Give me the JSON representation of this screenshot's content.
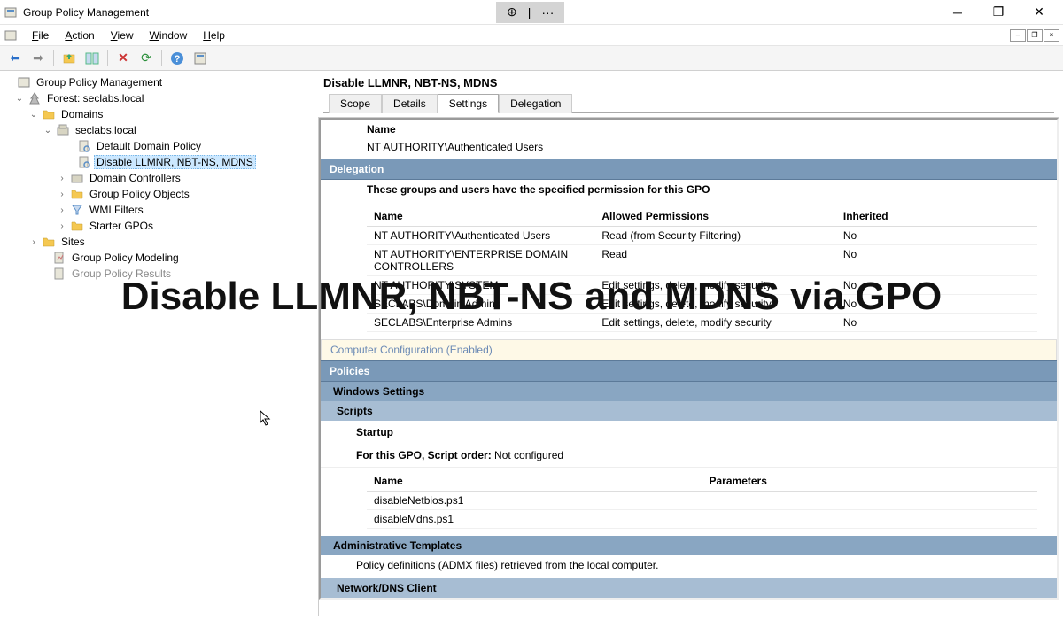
{
  "window": {
    "title": "Group Policy Management"
  },
  "menus": {
    "file": "File",
    "action": "Action",
    "view": "View",
    "window": "Window",
    "help": "Help"
  },
  "toolbar_tools": {
    "zoom": "⊕",
    "sep": "|",
    "more": "···"
  },
  "tree": {
    "root": "Group Policy Management",
    "forest": "Forest: seclabs.local",
    "domains": "Domains",
    "domain": "seclabs.local",
    "items": {
      "default_policy": "Default Domain Policy",
      "disable": "Disable LLMNR, NBT-NS, MDNS",
      "dc": "Domain Controllers",
      "gpo": "Group Policy Objects",
      "wmi": "WMI Filters",
      "starter": "Starter GPOs"
    },
    "sites": "Sites",
    "modeling": "Group Policy Modeling",
    "results": "Group Policy Results"
  },
  "detail": {
    "title": "Disable LLMNR, NBT-NS, MDNS",
    "tabs": {
      "scope": "Scope",
      "details": "Details",
      "settings": "Settings",
      "delegation": "Delegation"
    },
    "name_label": "Name",
    "auth_users": "NT AUTHORITY\\Authenticated Users",
    "delegation": {
      "header": "Delegation",
      "desc": "These groups and users have the specified permission for this GPO",
      "cols": {
        "name": "Name",
        "perms": "Allowed Permissions",
        "inherited": "Inherited"
      },
      "rows": [
        {
          "name": "NT AUTHORITY\\Authenticated Users",
          "perms": "Read (from Security Filtering)",
          "inh": "No"
        },
        {
          "name": "NT AUTHORITY\\ENTERPRISE DOMAIN CONTROLLERS",
          "perms": "Read",
          "inh": "No"
        },
        {
          "name": "NT AUTHORITY\\SYSTEM",
          "perms": "Edit settings, delete, modify security",
          "inh": "No"
        },
        {
          "name": "SECLABS\\Domain Admins",
          "perms": "Edit settings, delete, modify security",
          "inh": "No"
        },
        {
          "name": "SECLABS\\Enterprise Admins",
          "perms": "Edit settings, delete, modify security",
          "inh": "No"
        }
      ]
    },
    "config_header": "Computer Configuration (Enabled)",
    "policies": "Policies",
    "win_settings": "Windows Settings",
    "scripts": "Scripts",
    "startup": "Startup",
    "script_order_label": "For this GPO, Script order:",
    "script_order_value": " Not configured",
    "script_cols": {
      "name": "Name",
      "params": "Parameters"
    },
    "script_rows": [
      {
        "name": "disableNetbios.ps1",
        "params": ""
      },
      {
        "name": "disableMdns.ps1",
        "params": ""
      }
    ],
    "admin_templates": "Administrative Templates",
    "admx_desc": "Policy definitions (ADMX files) retrieved from the local computer.",
    "network_dns": "Network/DNS Client"
  },
  "overlay": "Disable LLMNR, NBT-NS and MDNS via GPO"
}
